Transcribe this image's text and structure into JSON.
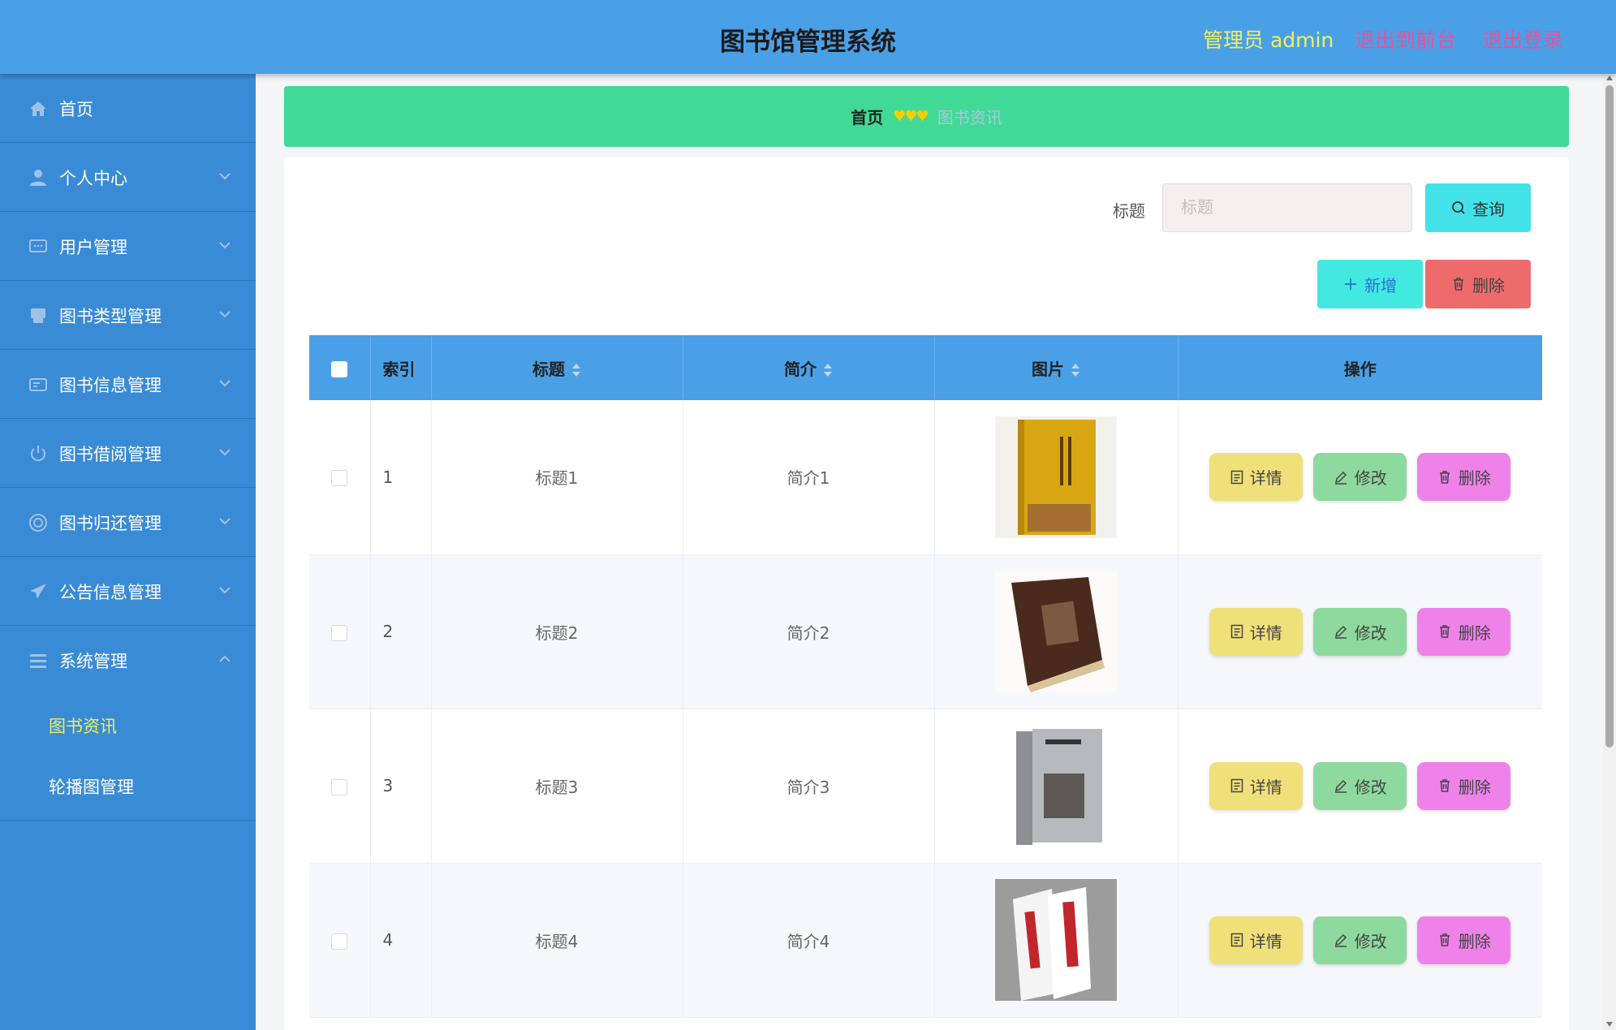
{
  "header": {
    "title": "图书馆管理系统",
    "admin_label": "管理员 admin",
    "front_link": "退出到前台",
    "logout_link": "退出登录"
  },
  "sidebar": {
    "items": [
      {
        "label": "首页",
        "icon": "home-icon"
      },
      {
        "label": "个人中心",
        "icon": "user-icon"
      },
      {
        "label": "用户管理",
        "icon": "chat-icon"
      },
      {
        "label": "图书类型管理",
        "icon": "printer-icon"
      },
      {
        "label": "图书信息管理",
        "icon": "id-card-icon"
      },
      {
        "label": "图书借阅管理",
        "icon": "power-icon"
      },
      {
        "label": "图书归还管理",
        "icon": "circle-icon"
      },
      {
        "label": "公告信息管理",
        "icon": "paper-plane-icon"
      },
      {
        "label": "系统管理",
        "icon": "menu-icon"
      }
    ],
    "submenu": [
      {
        "label": "图书资讯",
        "active": true
      },
      {
        "label": "轮播图管理",
        "active": false
      }
    ]
  },
  "breadcrumb": {
    "home": "首页",
    "separator": "♥♥♥",
    "current": "图书资讯"
  },
  "search": {
    "label": "标题",
    "placeholder": "标题",
    "query_button": "查询"
  },
  "toolbar": {
    "add_button": "新增",
    "delete_button": "删除"
  },
  "table": {
    "headers": {
      "index": "索引",
      "title": "标题",
      "summary": "简介",
      "image": "图片",
      "actions": "操作"
    },
    "rows": [
      {
        "index": "1",
        "title": "标题1",
        "summary": "简介1",
        "image": "book-cover-yellow"
      },
      {
        "index": "2",
        "title": "标题2",
        "summary": "简介2",
        "image": "book-cover-leather"
      },
      {
        "index": "3",
        "title": "标题3",
        "summary": "简介3",
        "image": "book-cover-gray"
      },
      {
        "index": "4",
        "title": "标题4",
        "summary": "简介4",
        "image": "book-cover-white"
      }
    ],
    "row_actions": {
      "detail": "详情",
      "edit": "修改",
      "remove": "删除"
    }
  },
  "colors": {
    "header_bg": "#4aa0e6",
    "sidebar_bg": "#3a8bd6",
    "breadcrumb_bg": "#41d996",
    "active_submenu": "#f0f060",
    "header_link": "#e0559f"
  }
}
